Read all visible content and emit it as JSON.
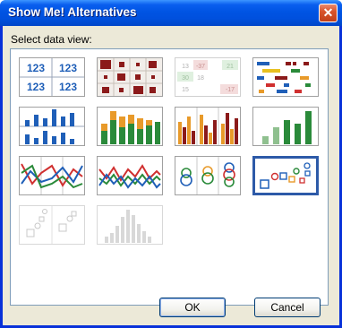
{
  "dialog": {
    "title": "Show Me! Alternatives",
    "close_symbol": "✕",
    "prompt": "Select data view:"
  },
  "views": [
    {
      "name": "text-table",
      "enabled": true,
      "selected": false,
      "labels": [
        "123",
        "123",
        "123",
        "123"
      ]
    },
    {
      "name": "heat-map",
      "enabled": true,
      "selected": false
    },
    {
      "name": "highlight-table",
      "enabled": false,
      "selected": false,
      "labels": [
        "13",
        "-37",
        "21",
        "30",
        "18",
        "15",
        "-17"
      ]
    },
    {
      "name": "gantt",
      "enabled": true,
      "selected": false
    },
    {
      "name": "bars-horizontal-panes",
      "enabled": true,
      "selected": false
    },
    {
      "name": "stacked-bars",
      "enabled": true,
      "selected": false
    },
    {
      "name": "side-by-side-bars",
      "enabled": true,
      "selected": false
    },
    {
      "name": "bars-single",
      "enabled": true,
      "selected": false
    },
    {
      "name": "lines-discrete",
      "enabled": true,
      "selected": false
    },
    {
      "name": "lines-continuous",
      "enabled": true,
      "selected": false
    },
    {
      "name": "circle-view",
      "enabled": true,
      "selected": false
    },
    {
      "name": "scatter-plot",
      "enabled": true,
      "selected": true
    },
    {
      "name": "scatter-matrix",
      "enabled": false,
      "selected": false
    },
    {
      "name": "histogram",
      "enabled": false,
      "selected": false
    }
  ],
  "buttons": {
    "ok": "OK",
    "cancel": "Cancel"
  },
  "colors": {
    "title_bar": "#0054e3",
    "dialog_face": "#ece9d8",
    "selection_border": "#2d5aa8",
    "blue": "#1f5fb8",
    "red": "#d03030",
    "green": "#2a8a3a",
    "orange": "#e89a2a",
    "maroon": "#8b1a1a"
  }
}
